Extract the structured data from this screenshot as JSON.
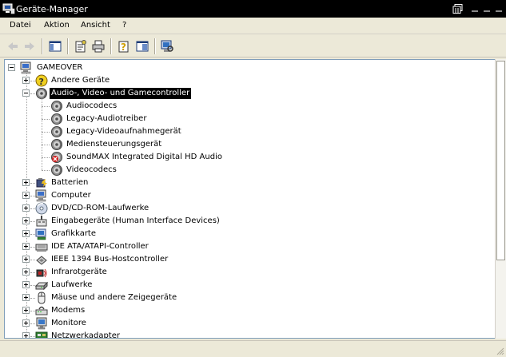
{
  "window": {
    "title": "Geräte-Manager",
    "app_icon": "device-manager-icon"
  },
  "menu": {
    "items": [
      "Datei",
      "Aktion",
      "Ansicht",
      "?"
    ]
  },
  "toolbar": {
    "buttons": [
      "back-arrow-icon",
      "forward-arrow-icon",
      "show-hide-console-tree-icon",
      "properties-icon",
      "print-icon",
      "help-icon",
      "toggle-pane-icon",
      "scan-hardware-icon"
    ]
  },
  "tree": {
    "root": {
      "label": "GAMEOVER",
      "icon": "computer-icon",
      "expanded": true
    },
    "categories": [
      {
        "label": "Andere Geräte",
        "icon": "unknown-device-icon",
        "expanded": false
      },
      {
        "label": "Audio-, Video- und Gamecontroller",
        "icon": "sound-icon",
        "expanded": true,
        "selected": true,
        "children": [
          {
            "label": "Audiocodecs",
            "icon": "sound-icon"
          },
          {
            "label": "Legacy-Audiotreiber",
            "icon": "sound-icon"
          },
          {
            "label": "Legacy-Videoaufnahmegerät",
            "icon": "sound-icon"
          },
          {
            "label": "Mediensteuerungsgerät",
            "icon": "sound-icon"
          },
          {
            "label": "SoundMAX Integrated Digital HD Audio",
            "icon": "disabled-device-icon"
          },
          {
            "label": "Videocodecs",
            "icon": "sound-icon"
          }
        ]
      },
      {
        "label": "Batterien",
        "icon": "battery-icon",
        "expanded": false
      },
      {
        "label": "Computer",
        "icon": "computer-icon",
        "expanded": false
      },
      {
        "label": "DVD/CD-ROM-Laufwerke",
        "icon": "cdrom-icon",
        "expanded": false
      },
      {
        "label": "Eingabegeräte (Human Interface Devices)",
        "icon": "hid-icon",
        "expanded": false
      },
      {
        "label": "Grafikkarte",
        "icon": "display-adapter-icon",
        "expanded": false
      },
      {
        "label": "IDE ATA/ATAPI-Controller",
        "icon": "ide-controller-icon",
        "expanded": false
      },
      {
        "label": "IEEE 1394 Bus-Hostcontroller",
        "icon": "firewire-icon",
        "expanded": false
      },
      {
        "label": "Infrarotgeräte",
        "icon": "infrared-icon",
        "expanded": false
      },
      {
        "label": "Laufwerke",
        "icon": "disk-drive-icon",
        "expanded": false
      },
      {
        "label": "Mäuse und andere Zeigegeräte",
        "icon": "mouse-icon",
        "expanded": false
      },
      {
        "label": "Modems",
        "icon": "modem-icon",
        "expanded": false
      },
      {
        "label": "Monitore",
        "icon": "monitor-icon",
        "expanded": false
      },
      {
        "label": "Netzwerkadapter",
        "icon": "network-adapter-icon",
        "expanded": false
      }
    ]
  },
  "colors": {
    "selection": "#000000",
    "tree_background": "#ffffff",
    "chrome": "#ece9d8",
    "titlebar": "#000000"
  }
}
